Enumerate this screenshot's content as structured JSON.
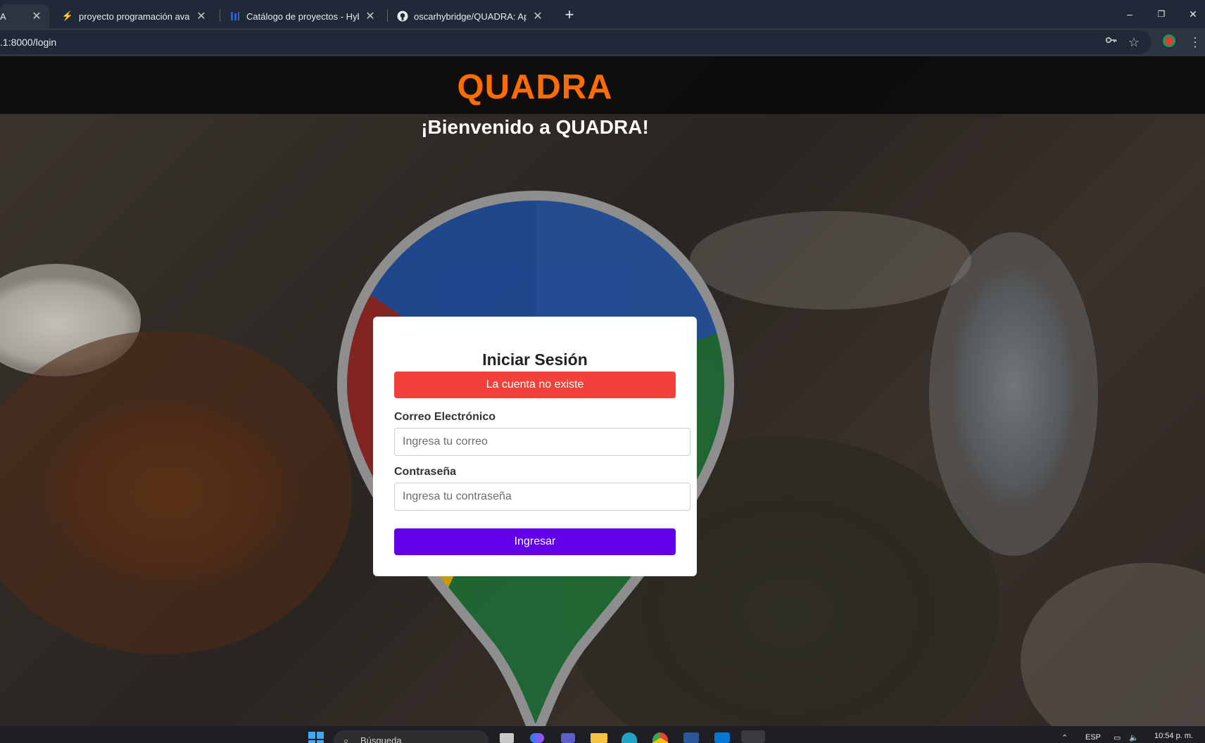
{
  "browser": {
    "tabs": [
      {
        "title": "A",
        "active": true
      },
      {
        "title": "proyecto programación avanzada",
        "active": false
      },
      {
        "title": "Catálogo de proyectos - Hybridge",
        "active": false
      },
      {
        "title": "oscarhybridge/QUADRA: Aplicación",
        "active": false
      }
    ],
    "new_tab_label": "+",
    "address": ".1:8000/login",
    "icons": [
      "key-icon",
      "star-icon",
      "profile-icon",
      "menu-icon"
    ],
    "window_controls": {
      "minimize": "–",
      "restore": "❐",
      "close": "✕"
    }
  },
  "page": {
    "brand": "QUADRA",
    "welcome": "¡Bienvenido a QUADRA!",
    "login": {
      "title": "Iniciar Sesión",
      "error": "La cuenta no existe",
      "email_label": "Correo Electrónico",
      "email_placeholder": "Ingresa tu correo",
      "email_value": "",
      "password_label": "Contraseña",
      "password_placeholder": "Ingresa tu contraseña",
      "password_value": "",
      "submit": "Ingresar"
    },
    "colors": {
      "brand": "#ff6d00",
      "error": "#f2403a",
      "primary_button": "#6200ea",
      "pin_blue": "#1e4a96",
      "pin_red": "#8a2420",
      "pin_green": "#1f6b35",
      "pin_yellow": "#d9a300"
    }
  },
  "taskbar": {
    "search_placeholder": "Búsqueda",
    "language": "ESP",
    "time": "10:54 p. m."
  }
}
